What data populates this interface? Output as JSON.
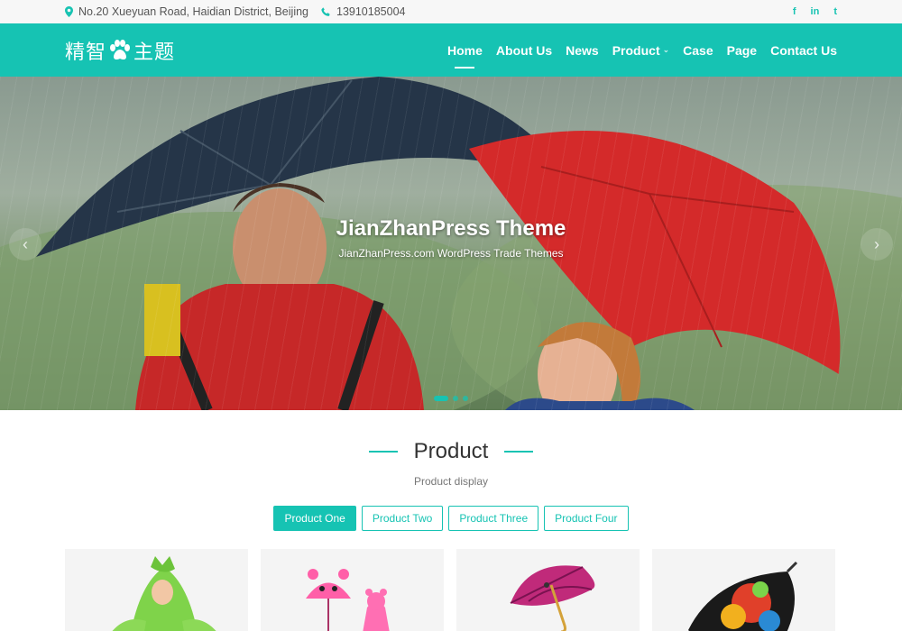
{
  "topbar": {
    "address": "No.20 Xueyuan Road, Haidian District, Beijing",
    "phone": "13910185004",
    "social": [
      {
        "name": "facebook-icon",
        "glyph": "f"
      },
      {
        "name": "linkedin-icon",
        "glyph": "in"
      },
      {
        "name": "twitter-icon",
        "glyph": "t"
      }
    ]
  },
  "header": {
    "logo_left": "精智",
    "logo_right": "主题",
    "nav": [
      {
        "label": "Home",
        "active": true
      },
      {
        "label": "About Us"
      },
      {
        "label": "News"
      },
      {
        "label": "Product",
        "dropdown": true
      },
      {
        "label": "Case"
      },
      {
        "label": "Page"
      },
      {
        "label": "Contact Us"
      }
    ]
  },
  "hero": {
    "title": "JianZhanPress Theme",
    "subtitle": "JianZhanPress.com WordPress Trade Themes",
    "prev_glyph": "‹",
    "next_glyph": "›",
    "slides": 3,
    "active_slide": 1
  },
  "product": {
    "heading": "Product",
    "subheading": "Product display",
    "tabs": [
      "Product One",
      "Product Two",
      "Product Three",
      "Product Four"
    ],
    "active_tab": 0,
    "cards": [
      "kids-raincoat-image",
      "pink-kids-umbrella-raincoat-image",
      "pink-umbrella-image",
      "floral-umbrella-image"
    ]
  },
  "colors": {
    "accent": "#16c3b3",
    "umbrella_red": "#d42a2a",
    "umbrella_navy": "#253548"
  }
}
